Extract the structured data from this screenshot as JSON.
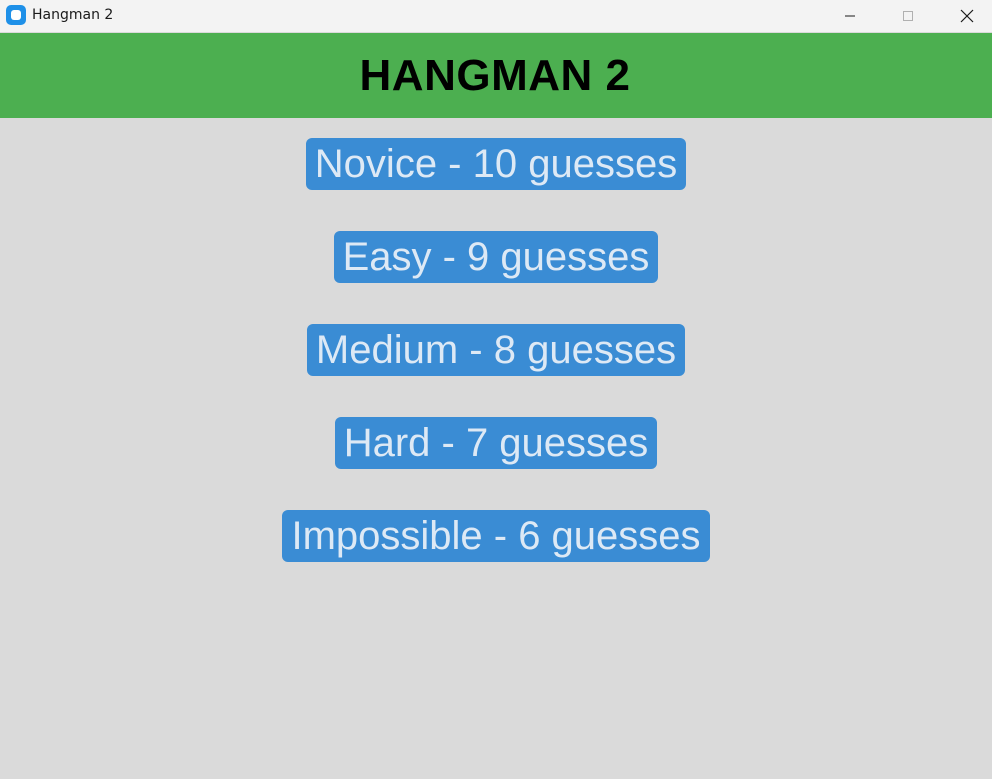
{
  "window": {
    "title": "Hangman 2",
    "app_icon": "app-icon",
    "controls": {
      "minimize_icon": "minimize-icon",
      "maximize_icon": "maximize-icon",
      "close_icon": "close-icon"
    }
  },
  "header": {
    "title": "HANGMAN 2",
    "background": "#4caf50"
  },
  "menu": {
    "button_color": "#3a8cd4",
    "button_text_color": "#dde9f5",
    "levels": [
      {
        "label": "Novice - 10 guesses"
      },
      {
        "label": "Easy - 9 guesses"
      },
      {
        "label": "Medium - 8 guesses"
      },
      {
        "label": "Hard - 7 guesses"
      },
      {
        "label": "Impossible - 6 guesses"
      }
    ]
  }
}
